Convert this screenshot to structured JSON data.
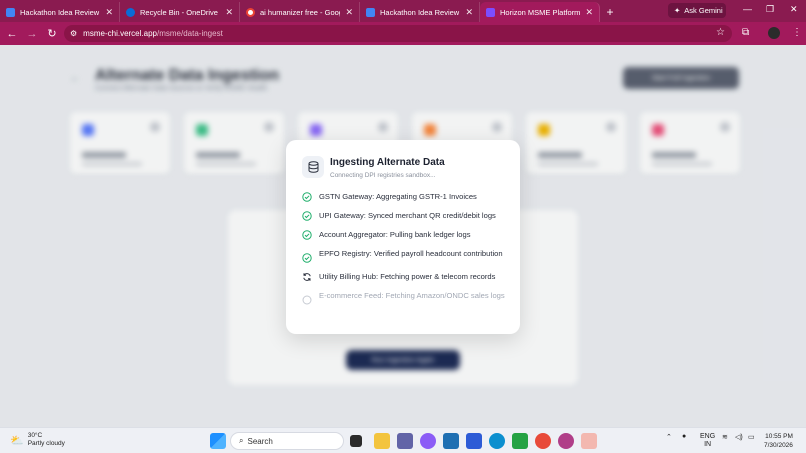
{
  "browser": {
    "tabs": [
      {
        "title": "Hackathon Idea Review",
        "color": "#4285f4"
      },
      {
        "title": "Recycle Bin - OneDrive",
        "color": "#0a6cd6"
      },
      {
        "title": "ai humanizer free - Google Se",
        "color": "#ffffff"
      },
      {
        "title": "Hackathon Idea Review",
        "color": "#4285f4"
      },
      {
        "title": "Horizon MSME Platform",
        "color": "#7c4dff"
      }
    ],
    "new_tab": "+",
    "ask_gemini": "Ask Gemini",
    "url_host": "msme-chi.vercel.app",
    "url_path": "/msme/data-ingest"
  },
  "page": {
    "title": "Alternate Data Ingestion",
    "subtitle": "Connect Alternate Data Sources to Verify MSME Health",
    "action_button": "Start Full Ingestion",
    "cards": [
      {
        "color": "#5b7cff"
      },
      {
        "color": "#3ec48b"
      },
      {
        "color": "#8e6bff"
      },
      {
        "color": "#ff8a3d"
      },
      {
        "color": "#f5b800"
      },
      {
        "color": "#f0507c"
      }
    ],
    "go_button": "Run Ingestion Again"
  },
  "modal": {
    "title": "Ingesting Alternate Data",
    "subtitle": "Connecting DPI registries sandbox...",
    "steps": [
      {
        "label": "GSTN Gateway: Aggregating GSTR-1 Invoices",
        "status": "done"
      },
      {
        "label": "UPI Gateway: Synced merchant QR credit/debit logs",
        "status": "done"
      },
      {
        "label": "Account Aggregator: Pulling bank ledger logs",
        "status": "done"
      },
      {
        "label": "EPFO Registry: Verified payroll headcount contribution",
        "status": "done"
      },
      {
        "label": "Utility Billing Hub: Fetching power & telecom records",
        "status": "active"
      },
      {
        "label": "E-commerce Feed: Fetching Amazon/ONDC sales logs",
        "status": "pending"
      }
    ],
    "colors": {
      "done": "#1fae6b",
      "active": "#2a2f3c",
      "pending": "#c6cad2"
    }
  },
  "taskbar": {
    "weather_temp": "30°C",
    "weather_desc": "Partly cloudy",
    "search_label": "Search",
    "lang": "ENG",
    "region": "IN",
    "time": "10:55 PM",
    "date": "7/30/2026"
  }
}
